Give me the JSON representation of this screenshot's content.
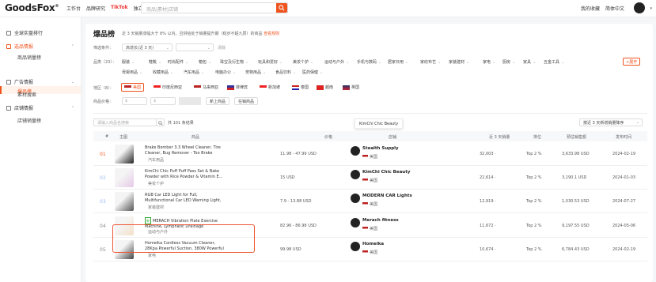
{
  "topbar": {
    "logo": "GoodsFox",
    "nav": [
      "工作台",
      "品牌研究",
      "TikTok",
      "独立站"
    ],
    "search_placeholder": "商品|素材|店铺",
    "links": [
      "我的收藏",
      "简体中文"
    ]
  },
  "sidebar": {
    "g1": "全球实盘排行",
    "g2": "选品情报",
    "g2_items": [
      "商品销量榜",
      "爆品榜"
    ],
    "g3": "广告情报",
    "g3_items": [
      "素材搜索"
    ],
    "g4": "店铺情报",
    "g4_items": [
      "店铺销量榜"
    ]
  },
  "main": {
    "title": "爆品榜",
    "desc": "近 3 天销量涨幅大于 8% 以内，且供给处于销量提升期（稳步不超九层）的商品",
    "desc_link": "查看规则",
    "f_condition": "筛选条件：",
    "f_condition_val": "高增长(近 3 天)",
    "reset": "清除",
    "f_category": "品类（23）：",
    "categories_row1": [
      "服装",
      "鞋靴",
      "时尚配件",
      "箱包",
      "珠宝及衍生物",
      "玩具和爱好",
      "美妆个护",
      "运动与户外",
      "手机与数码",
      "居家日用",
      "家纺布艺",
      "家装建材",
      "家电",
      "厨房",
      "家具",
      "五金工具"
    ],
    "categories_row2": [
      "母婴用品",
      "收藏用品",
      "汽车用品",
      "电脑办公",
      "宠物用品",
      "食品饮料",
      "医药保健"
    ],
    "expand": "+展开",
    "f_region": "地区（8）：",
    "regions": [
      "美国",
      "印度尼西亚",
      "马来西亚",
      "菲律宾",
      "新加坡",
      "泰国",
      "越南",
      "英国"
    ],
    "f_price": "商品价格：",
    "price_min": "$",
    "price_max": "$",
    "btn_new": "新上商品",
    "btn_instock": "在销商品",
    "table_search": "请输入商品名搜索",
    "count": "共 101 条结果",
    "tooltip": "KimChi Chic Beauty",
    "sort": "按近 3 天新增销量降序",
    "headers": [
      "#",
      "主图",
      "商品",
      "价格",
      "店铺",
      "近 3 天销量",
      "排位",
      "预估销售额",
      "发布时间"
    ],
    "rows": [
      {
        "rank": "01",
        "name": "Brake Bomber 3.3 Wheel Cleaner, Tire Cleaner, Bug Remover - Too Brake Cleane...",
        "tag": "汽车用品",
        "price": "11.98 - 47.99 USD",
        "shop": "Stealth Supply",
        "region": "美国",
        "sales": "32,003 ·",
        "trank": "Top 2 %",
        "gmv": "3,633.98 USD",
        "date": "2024-02-19"
      },
      {
        "rank": "02",
        "name": "KimChi Chic Puff Puff Pass Set & Bake Powder with Rice Powder & Vitamin E...",
        "tag": "美妆个护",
        "price": "15 USD",
        "shop": "KimChi Chic Beauty",
        "region": "美国",
        "sales": "22,614 ·",
        "trank": "Top 2 %",
        "gmv": "3,190.1 USD",
        "date": "2024-01-03"
      },
      {
        "rank": "03",
        "name": "RGB Car LED Light for Full, Multifunctional Car LED Warning Light, Rechargeable...",
        "tag": "家装建材",
        "price": "7.9 - 13.88 USD",
        "shop": "MODERN CAR Lights",
        "region": "美国",
        "sales": "12,919 ·",
        "trank": "Top 2 %",
        "gmv": "1,030.53 USD",
        "date": "2024-07-27"
      },
      {
        "rank": "04",
        "name": "MERACH Vibration Plate Exercise Machine, Lymphatic Drainage Machine,...",
        "tag": "运动与户外",
        "price": "82.96 - 86.98 USD",
        "shop": "Merach fitness",
        "region": "美国",
        "sales": "11,672 ·",
        "trank": "Top 2 %",
        "gmv": "9,197.55 USD",
        "date": "2024-05-06",
        "newtag": "新"
      },
      {
        "rank": "05",
        "name": "Homeika Cordless Vacuum Cleaner, 28Kpa Powerful Suction, 380W Powerful Brushle...",
        "tag": "家电",
        "price": "99.98 USD",
        "shop": "Homeika",
        "region": "美国",
        "sales": "10,674 ·",
        "trank": "Top 2 %",
        "gmv": "6,784.43 USD",
        "date": "2024-02-19"
      }
    ]
  },
  "colors": {
    "accent": "#f0541e",
    "highlight": "#e53333"
  }
}
